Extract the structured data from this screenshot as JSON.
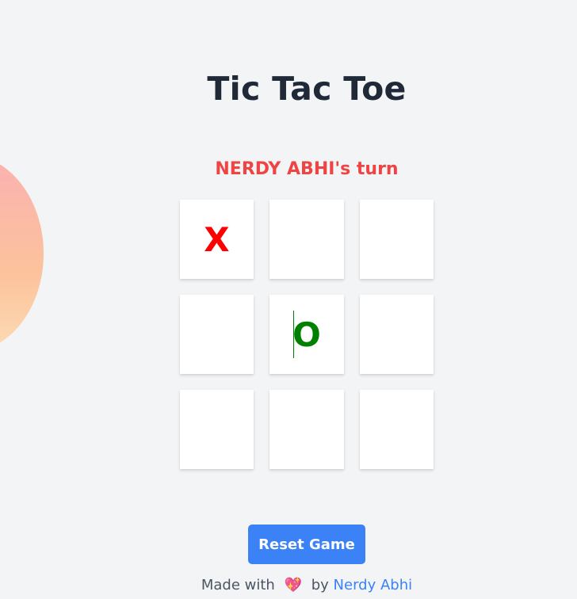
{
  "app": {
    "title": "Tic Tac Toe",
    "status": "NERDY ABHI's turn"
  },
  "board": {
    "cells": [
      "X",
      "",
      "",
      "",
      "O",
      "",
      "",
      "",
      ""
    ]
  },
  "controls": {
    "reset_label": "Reset Game"
  },
  "footer": {
    "prefix": "Made with",
    "heart": "💖",
    "by": "by",
    "author": "Nerdy Abhi"
  },
  "colors": {
    "background": "#f3f4f6",
    "title": "#1f2937",
    "status": "#ef4444",
    "x_mark": "#ff0000",
    "o_mark": "#008000",
    "button": "#3b82f6",
    "link": "#3b82f6"
  }
}
